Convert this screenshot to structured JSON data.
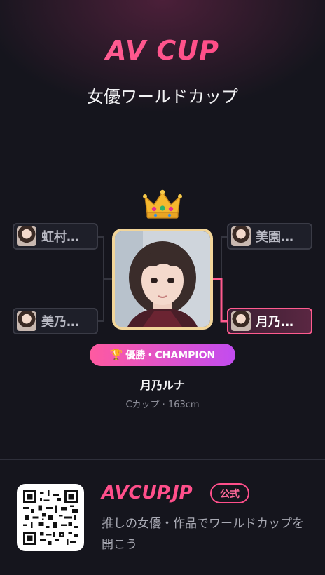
{
  "header": {
    "brand": "AV CUP",
    "subtitle": "女優ワールドカップ"
  },
  "bracket": {
    "left": [
      {
        "name": "虹村…",
        "winner": false
      },
      {
        "name": "美乃…",
        "winner": false
      }
    ],
    "right": [
      {
        "name": "美園…",
        "winner": false
      },
      {
        "name": "月乃…",
        "winner": true
      }
    ]
  },
  "champion": {
    "badge_icon": "trophy-icon",
    "badge_label": "優勝・CHAMPION",
    "name": "月乃ルナ",
    "meta": "Cカップ · 163cm",
    "frame_color": "#f1d59a",
    "crown_icon": "crown-icon"
  },
  "footer": {
    "site": "AVCUP.JP",
    "official_label": "公式",
    "tagline": "推しの女優・作品でワールドカップを開こう",
    "qr_icon": "qr-code-icon"
  },
  "colors": {
    "accent": "#ff4f8b",
    "background": "#15151d",
    "badge_gradient_start": "#ff5aa0",
    "badge_gradient_end": "#c24cf0"
  }
}
